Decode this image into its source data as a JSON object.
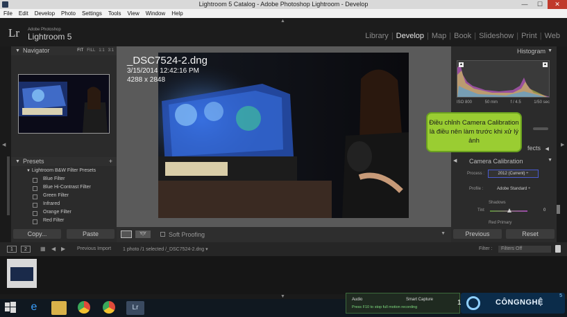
{
  "window": {
    "title": "Lightroom 5 Catalog - Adobe Photoshop Lightroom - Develop",
    "buttons": {
      "minimize": "—",
      "maximize": "☐",
      "close": "✕"
    }
  },
  "menu": [
    "File",
    "Edit",
    "Develop",
    "Photo",
    "Settings",
    "Tools",
    "View",
    "Window",
    "Help"
  ],
  "app": {
    "logo": "Lr",
    "adobe": "Adobe Photoshop",
    "name": "Lightroom 5"
  },
  "modules": [
    {
      "label": "Library",
      "active": false
    },
    {
      "label": "Develop",
      "active": true
    },
    {
      "label": "Map",
      "active": false
    },
    {
      "label": "Book",
      "active": false
    },
    {
      "label": "Slideshow",
      "active": false
    },
    {
      "label": "Print",
      "active": false
    },
    {
      "label": "Web",
      "active": false
    }
  ],
  "navigator": {
    "title": "Navigator",
    "options": [
      "FIT",
      "FILL",
      "1:1",
      "3:1"
    ]
  },
  "presets": {
    "title": "Presets",
    "add": "+",
    "group": "Lightroom B&W Filter Presets",
    "items": [
      "Blue Filter",
      "Blue Hi-Contrast Filter",
      "Green Filter",
      "Infrared",
      "Orange Filter",
      "Red Filter"
    ]
  },
  "left_buttons": {
    "copy": "Copy...",
    "paste": "Paste"
  },
  "photo_info": {
    "filename": "_DSC7524-2.dng",
    "datetime": "3/15/2014 12:42:16 PM",
    "dimensions": "4288 x 2848"
  },
  "toolbar": {
    "soft_proofing": "Soft Proofing",
    "view_label": "Y|Y"
  },
  "histogram": {
    "title": "Histogram",
    "exif": [
      "ISO 800",
      "50 mm",
      "f / 4.5",
      "1/50 sec"
    ]
  },
  "callout": "Điều chỉnh Camera Calibration là điều nên  làm trước khi xử lý ảnh",
  "effects": {
    "label": "fects"
  },
  "camera_calibration": {
    "label": "Camera Calibration",
    "process_label": "Process :",
    "process_value": "2012 (Current) ÷",
    "profile_label": "Profile :",
    "profile_value": "Adobe Standard ÷",
    "shadows_label": "Shadows",
    "tint_label": "Tint",
    "tint_value": "0",
    "red_primary": "Red Primary"
  },
  "right_buttons": {
    "previous": "Previous",
    "reset": "Reset"
  },
  "filmbar": {
    "page1": "1",
    "page2": "2",
    "source": "Previous Import",
    "selection": "1 photo /1 selected /_DSC7524-2.dng ▾",
    "filter_label": "Filter :",
    "filter_value": "Filters Off"
  },
  "recorder": {
    "audio": "Audio",
    "capture": "Smart Capture",
    "hint": "Press F10 to stop full motion recording",
    "time": "1:07"
  },
  "watermark": {
    "text": "CÔNGNGHỆ",
    "suffix": "5"
  },
  "colors": {
    "callout_bg": "#9acd32",
    "select_border": "#4a5bd0",
    "active_module": "#e6e6e6"
  }
}
